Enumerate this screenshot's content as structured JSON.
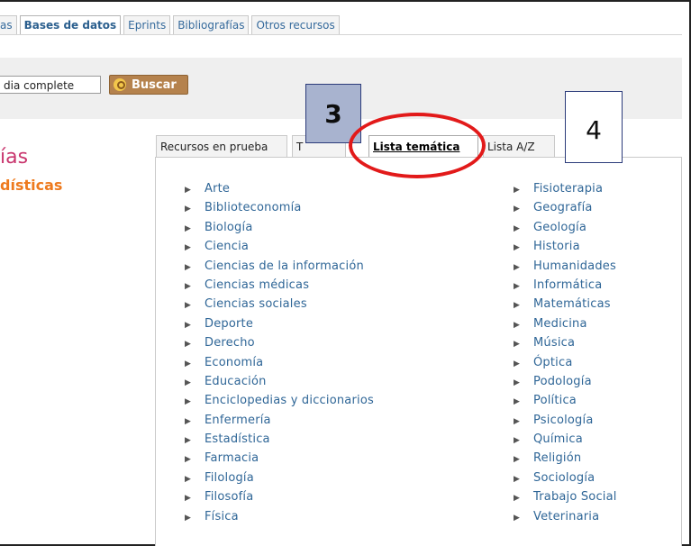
{
  "top_tabs": [
    {
      "label": "as",
      "active": false
    },
    {
      "label": "Bases de datos",
      "active": true
    },
    {
      "label": "Eprints",
      "active": false
    },
    {
      "label": "Bibliografías",
      "active": false
    },
    {
      "label": "Otros recursos",
      "active": false
    }
  ],
  "search": {
    "value": "dia complete",
    "button_label": "Buscar"
  },
  "sidebar": {
    "title": "ías",
    "subtitle": "dísticas"
  },
  "sub_tabs": [
    {
      "label": "Recursos en prueba",
      "active": false
    },
    {
      "label": "T",
      "active": false
    },
    {
      "label": "Lista temática",
      "active": true
    },
    {
      "label": "Lista A/Z",
      "active": false
    }
  ],
  "annotations": {
    "box3": "3",
    "box4": "4",
    "highlight_color": "#e21a1a"
  },
  "topics_left": [
    "Arte",
    "Biblioteconomía",
    "Biología",
    "Ciencia",
    "Ciencias de la información",
    "Ciencias médicas",
    "Ciencias sociales",
    "Deporte",
    "Derecho",
    "Economía",
    "Educación",
    "Enciclopedias y diccionarios",
    "Enfermería",
    "Estadística",
    "Farmacia",
    "Filología",
    "Filosofía",
    "Física"
  ],
  "topics_right": [
    "Fisioterapia",
    "Geografía",
    "Geología",
    "Historia",
    "Humanidades",
    "Informática",
    "Matemáticas",
    "Medicina",
    "Música",
    "Óptica",
    "Podología",
    "Política",
    "Psicología",
    "Química",
    "Religión",
    "Sociología",
    "Trabajo Social",
    "Veterinaria"
  ],
  "colors": {
    "link": "#2f6697",
    "title": "#c9366e",
    "subtitle": "#ee7a1e",
    "button": "#b5824d"
  }
}
